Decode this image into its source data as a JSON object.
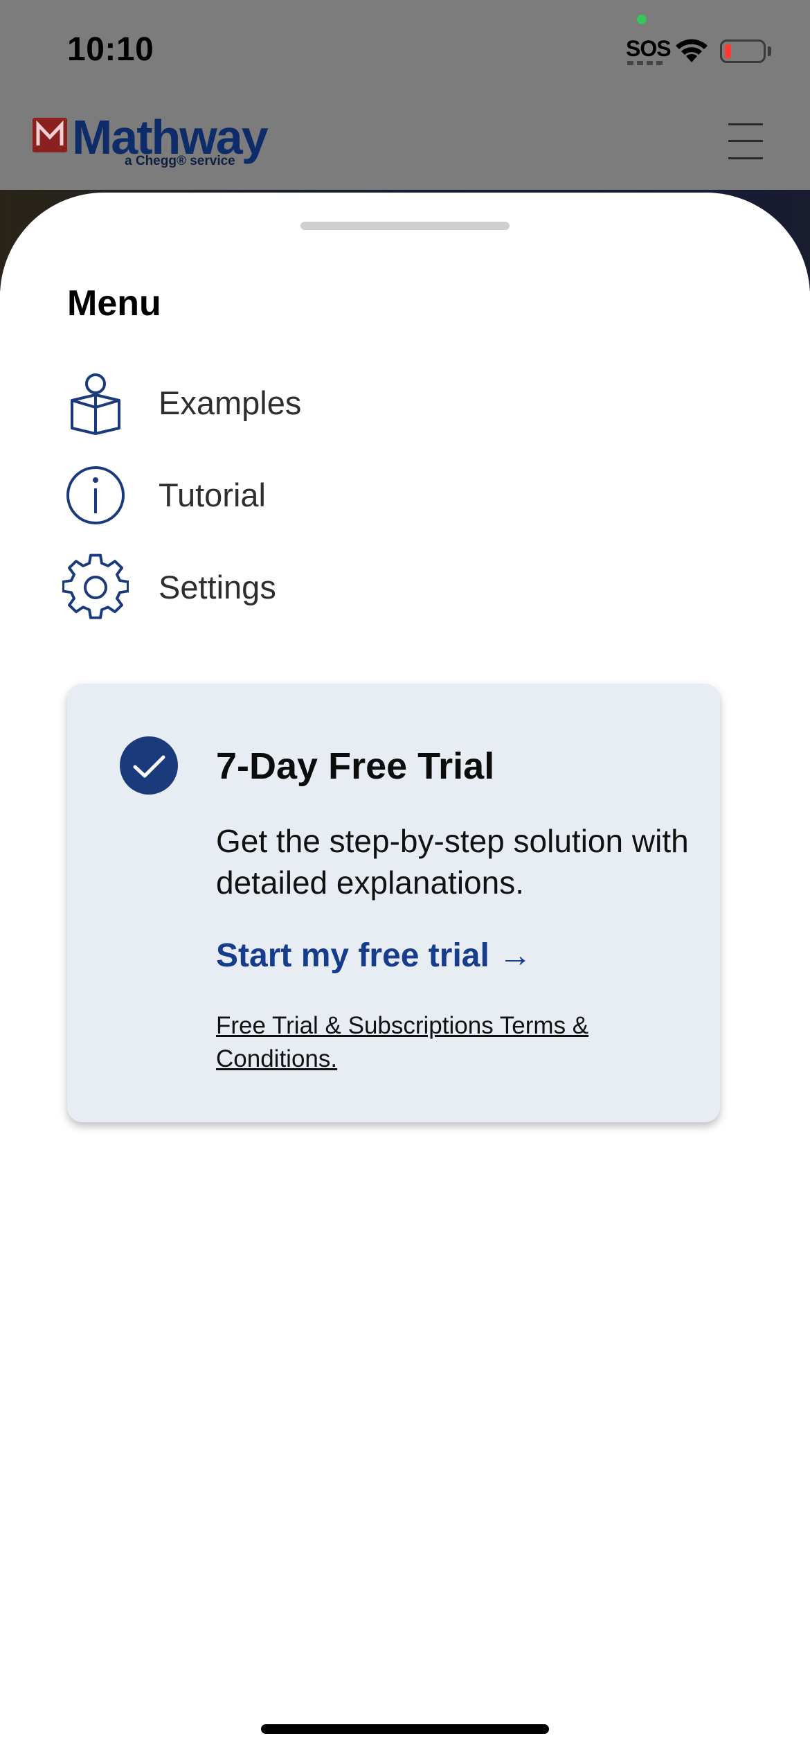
{
  "status_bar": {
    "time": "10:10",
    "sos": "SOS"
  },
  "header": {
    "logo_text": "Mathway",
    "logo_subtitle": "a Chegg® service",
    "colors": {
      "brand_navy": "#0e2c6a",
      "brand_red": "#8a2020"
    }
  },
  "menu": {
    "title": "Menu",
    "items": [
      {
        "label": "Examples",
        "icon": "book-reader-icon"
      },
      {
        "label": "Tutorial",
        "icon": "info-icon"
      },
      {
        "label": "Settings",
        "icon": "gear-icon"
      }
    ]
  },
  "trial": {
    "title": "7-Day Free Trial",
    "description": "Get the step-by-step solution with detailed explanations.",
    "cta": "Start my free trial →",
    "terms": "Free Trial & Subscriptions Terms & Conditions.",
    "colors": {
      "card_bg": "#e8edf4",
      "accent": "#163c8c"
    }
  }
}
